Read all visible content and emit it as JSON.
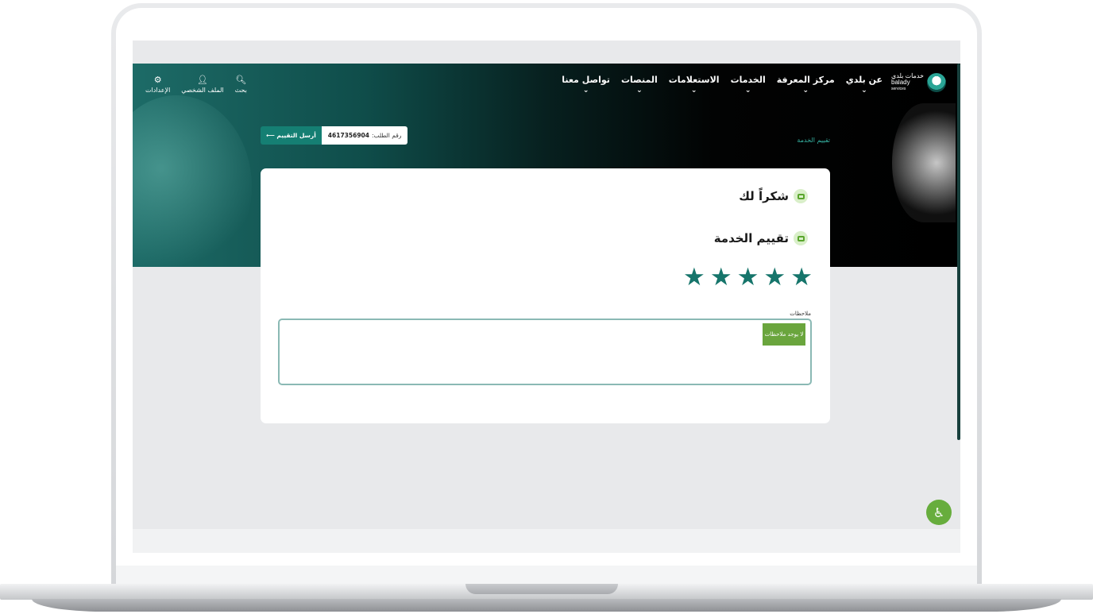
{
  "nav": {
    "logo_text_ar": "خدمات بلدي",
    "logo_text_en": "balady",
    "logo_sub": "services",
    "menu": [
      {
        "label": "عن بلدي"
      },
      {
        "label": "مركز المعرفة"
      },
      {
        "label": "الخدمات"
      },
      {
        "label": "الاستعلامات"
      },
      {
        "label": "المنصات"
      },
      {
        "label": "تواصل معنا"
      }
    ],
    "tools": [
      {
        "label": "بحث",
        "icon": "search-icon"
      },
      {
        "label": "الملف الشخصي",
        "icon": "user-icon"
      },
      {
        "label": "الإعدادات",
        "icon": "gear-icon"
      }
    ]
  },
  "breadcrumb": "تقييم الخدمة",
  "request": {
    "label": "رقم الطلب:",
    "number": "4617356904",
    "send_label": "أرسل التقييم"
  },
  "card": {
    "thanks_title": "شكراً لك",
    "rating_title": "تقييم الخدمة",
    "rating": 5,
    "max_rating": 5,
    "notes_label": "ملاحظات",
    "notes_value": "لا يوجد ملاحظات"
  },
  "colors": {
    "brand_green": "#157f73",
    "star": "#16756b",
    "accent_lime": "#6aa53d"
  }
}
